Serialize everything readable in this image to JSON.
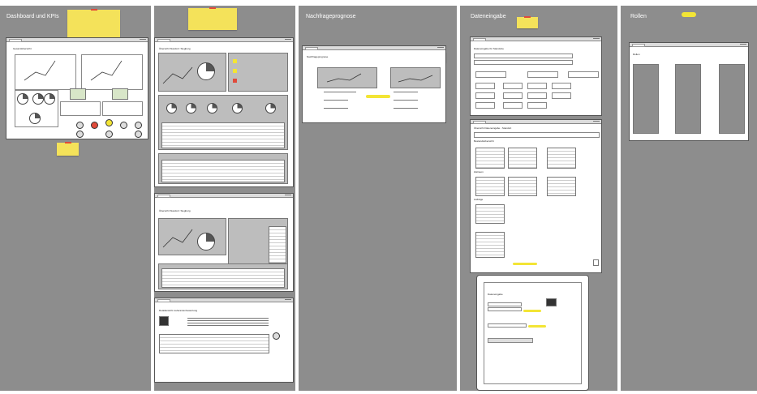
{
  "lanes": [
    {
      "id": "dashboard",
      "title": "Dashboard und KPIs"
    },
    {
      "id": "forecast",
      "title": "Nachfrageprognose"
    },
    {
      "id": "input",
      "title": "Dateneingabe"
    },
    {
      "id": "roles",
      "title": "Rollen"
    }
  ],
  "wireframes": {
    "dashboard_overview_title": "Gesamtübersicht",
    "site_overview_title": "Übersicht Standort: Siegburg",
    "forecast_title": "Nachfrageprognose",
    "data_entry_title": "Dateneingabe für Standorte",
    "data_entry_detail_title": "Übersicht Dateneingabe - Standort",
    "inventory_label": "Bestandsübersicht",
    "time_label": "Zeitraum",
    "orders_label": "Aufträge",
    "roles_label": "Rollen",
    "mobile_title": "Dateneingabe",
    "detail_title": "Detailansicht Lieferantenbewertung"
  },
  "colors": {
    "lane": "#8d8d8d",
    "note": "#f4e25a",
    "pin": "#e04a3a",
    "wire_bg": "#ffffff",
    "panel": "#bdbdbd"
  }
}
